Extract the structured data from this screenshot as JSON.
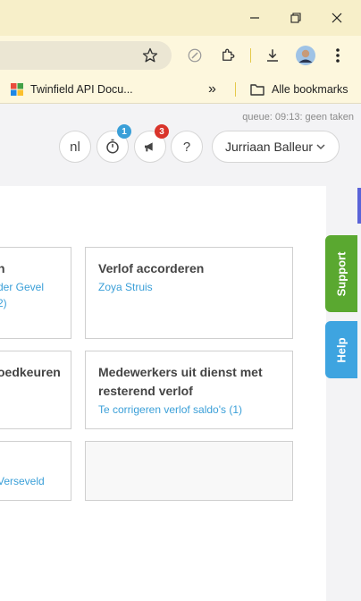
{
  "browser": {
    "bookmarks": {
      "item1": "Twinfield API Docu...",
      "overflow": "»",
      "all": "Alle bookmarks"
    }
  },
  "header": {
    "queue": "queue: 09:13: geen taken",
    "language": "nl",
    "timer_badge": "1",
    "announcements_badge": "3",
    "help": "?",
    "user_name": "Jurriaan Balleur"
  },
  "cards": {
    "c1": {
      "title": "n",
      "link1": "der Gevel",
      "link2": "2)"
    },
    "c2": {
      "title": "Verlof accorderen",
      "link1": "Zoya Struis"
    },
    "c3": {
      "title": "oedkeuren"
    },
    "c4": {
      "title_line1": "Medewerkers uit dienst met",
      "title_line2": "resterend verlof",
      "link1": "Te corrigeren verlof saldo's (1)"
    },
    "c5": {
      "link1": "Verseveld"
    }
  },
  "side": {
    "support": "Support",
    "help": "Help"
  },
  "colors": {
    "support": "#5aa830",
    "help": "#3ea4e0",
    "badge_blue": "#3a9fd8",
    "badge_red": "#d9342b",
    "link": "#3a9fd8"
  }
}
